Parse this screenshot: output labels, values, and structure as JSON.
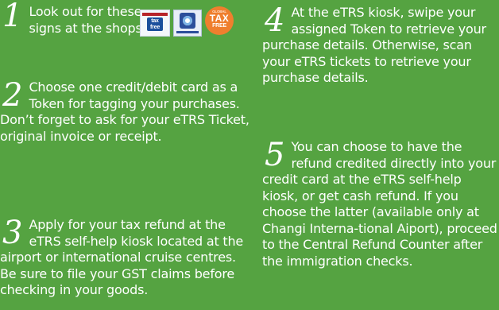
{
  "steps": [
    {
      "number": "1",
      "lines": [
        "Look out for these",
        "signs at the shops."
      ]
    },
    {
      "number": "2",
      "text": "Choose one credit/debit card as a Token for tagging your purchases. Don’t forget to ask for your eTRS Ticket, original invoice or receipt."
    },
    {
      "number": "3",
      "text": "Apply for your tax refund at the eTRS self-help kiosk located at the airport or international cruise centres. Be sure to file your GST claims before checking in your goods."
    },
    {
      "number": "4",
      "text": "At the eTRS kiosk, swipe your assigned Token to retrieve your purchase details. Otherwise, scan your eTRS tickets to retrieve your purchase details."
    },
    {
      "number": "5",
      "text": "You can choose to have the refund credited directly into your credit card at the eTRS self-help kiosk, or get cash refund. If you choose the latter (available only at Changi Interna-tional Aiport), proceed to the Central Refund Counter after the immigration checks."
    }
  ],
  "signs": {
    "premier": {
      "icon": "tax-free-shopping-bag-logo",
      "line1": "tax",
      "line2": "free"
    },
    "premium": {
      "icon": "premium-tax-free-logo"
    },
    "global": {
      "icon": "global-tax-free-logo",
      "line1": "GLOBAL",
      "line2": "TAX",
      "line3": "FREE"
    }
  },
  "colors": {
    "background": "#55a341",
    "text": "#ffffff",
    "global_badge": "#ef7f2e",
    "premium_badge": "#2c4e9b"
  }
}
